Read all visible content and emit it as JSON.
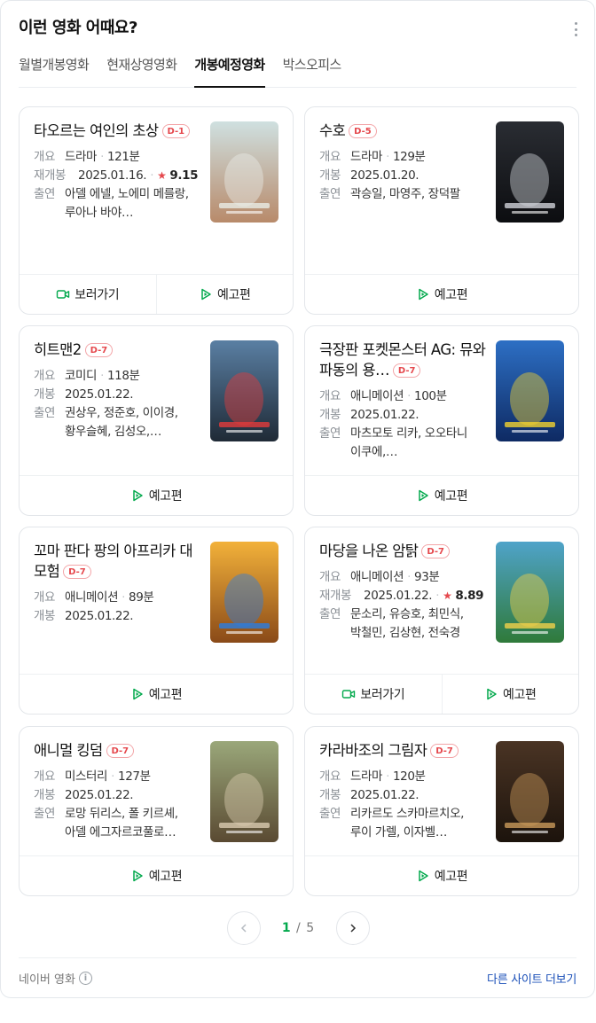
{
  "header": {
    "title": "이런 영화 어때요?"
  },
  "tabs": [
    {
      "label": "월별개봉영화"
    },
    {
      "label": "현재상영영화"
    },
    {
      "label": "개봉예정영화"
    },
    {
      "label": "박스오피스"
    }
  ],
  "active_tab": "개봉예정영화",
  "labels": {
    "genre": "개요",
    "release": "개봉",
    "rerelease": "재개봉",
    "cast": "출연",
    "watch": "보러가기",
    "trailer": "예고편"
  },
  "movies": [
    {
      "title": "타오르는 여인의 초상",
      "dday": "D-1",
      "genre": "드라마",
      "runtime": "121분",
      "release_label": "재개봉",
      "date": "2025.01.16.",
      "rating": "9.15",
      "cast": "아델 에넬, 노에미 메를랑, 루아나 바야…",
      "watch": true,
      "poster": {
        "bg1": "#cfe0e0",
        "bg2": "#b88a6a",
        "accent": "#e9ece6"
      }
    },
    {
      "title": "수호",
      "dday": "D-5",
      "genre": "드라마",
      "runtime": "129분",
      "release_label": "개봉",
      "date": "2025.01.20.",
      "rating": "",
      "cast": "곽승일, 마영주, 장덕팔",
      "watch": false,
      "poster": {
        "bg1": "#2a2d33",
        "bg2": "#0c0d10",
        "accent": "#cfd2d8"
      }
    },
    {
      "title": "히트맨2",
      "dday": "D-7",
      "genre": "코미디",
      "runtime": "118분",
      "release_label": "개봉",
      "date": "2025.01.22.",
      "rating": "",
      "cast": "권상우, 정준호, 이이경, 황우슬혜, 김성오,…",
      "watch": false,
      "poster": {
        "bg1": "#5a7fa3",
        "bg2": "#1f2a36",
        "accent": "#e23b3b"
      }
    },
    {
      "title": "극장판 포켓몬스터 AG: 뮤와 파동의 용…",
      "dday": "D-7",
      "genre": "애니메이션",
      "runtime": "100분",
      "release_label": "개봉",
      "date": "2025.01.22.",
      "rating": "",
      "cast": "마츠모토 리카, 오오타니 이쿠에,…",
      "watch": false,
      "poster": {
        "bg1": "#2d6fc4",
        "bg2": "#0e2a63",
        "accent": "#f2d22e"
      }
    },
    {
      "title": "꼬마 판다 팡의 아프리카 대모험",
      "dday": "D-7",
      "genre": "애니메이션",
      "runtime": "89분",
      "release_label": "개봉",
      "date": "2025.01.22.",
      "rating": "",
      "cast": "",
      "watch": false,
      "poster": {
        "bg1": "#f2b13a",
        "bg2": "#8a4a18",
        "accent": "#2a7de0"
      }
    },
    {
      "title": "마당을 나온 암탉",
      "dday": "D-7",
      "genre": "애니메이션",
      "runtime": "93분",
      "release_label": "재개봉",
      "date": "2025.01.22.",
      "rating": "8.89",
      "cast": "문소리, 유승호, 최민식, 박철민, 김상현, 전숙경",
      "watch": true,
      "poster": {
        "bg1": "#4fa3c9",
        "bg2": "#2f7a3a",
        "accent": "#f1d04a"
      }
    },
    {
      "title": "애니멀 킹덤",
      "dday": "D-7",
      "genre": "미스터리",
      "runtime": "127분",
      "release_label": "개봉",
      "date": "2025.01.22.",
      "rating": "",
      "cast": "로망 뒤리스, 폴 키르셰, 아델 에그자르코풀로…",
      "watch": false,
      "poster": {
        "bg1": "#9aa77a",
        "bg2": "#5a4a32",
        "accent": "#d9cbb0"
      }
    },
    {
      "title": "카라바조의 그림자",
      "dday": "D-7",
      "genre": "드라마",
      "runtime": "120분",
      "release_label": "개봉",
      "date": "2025.01.22.",
      "rating": "",
      "cast": "리카르도 스카마르치오, 루이 가렐, 이자벨…",
      "watch": false,
      "poster": {
        "bg1": "#4a3424",
        "bg2": "#1c130c",
        "accent": "#c99a5a"
      }
    }
  ],
  "pagination": {
    "current": "1",
    "separator": "/",
    "total": "5"
  },
  "footer": {
    "source": "네이버 영화",
    "more_link": "다른 사이트 더보기"
  },
  "colors": {
    "accent_green": "#03a94d",
    "dday_red": "#e5484d",
    "link_blue": "#1a4fb8"
  }
}
